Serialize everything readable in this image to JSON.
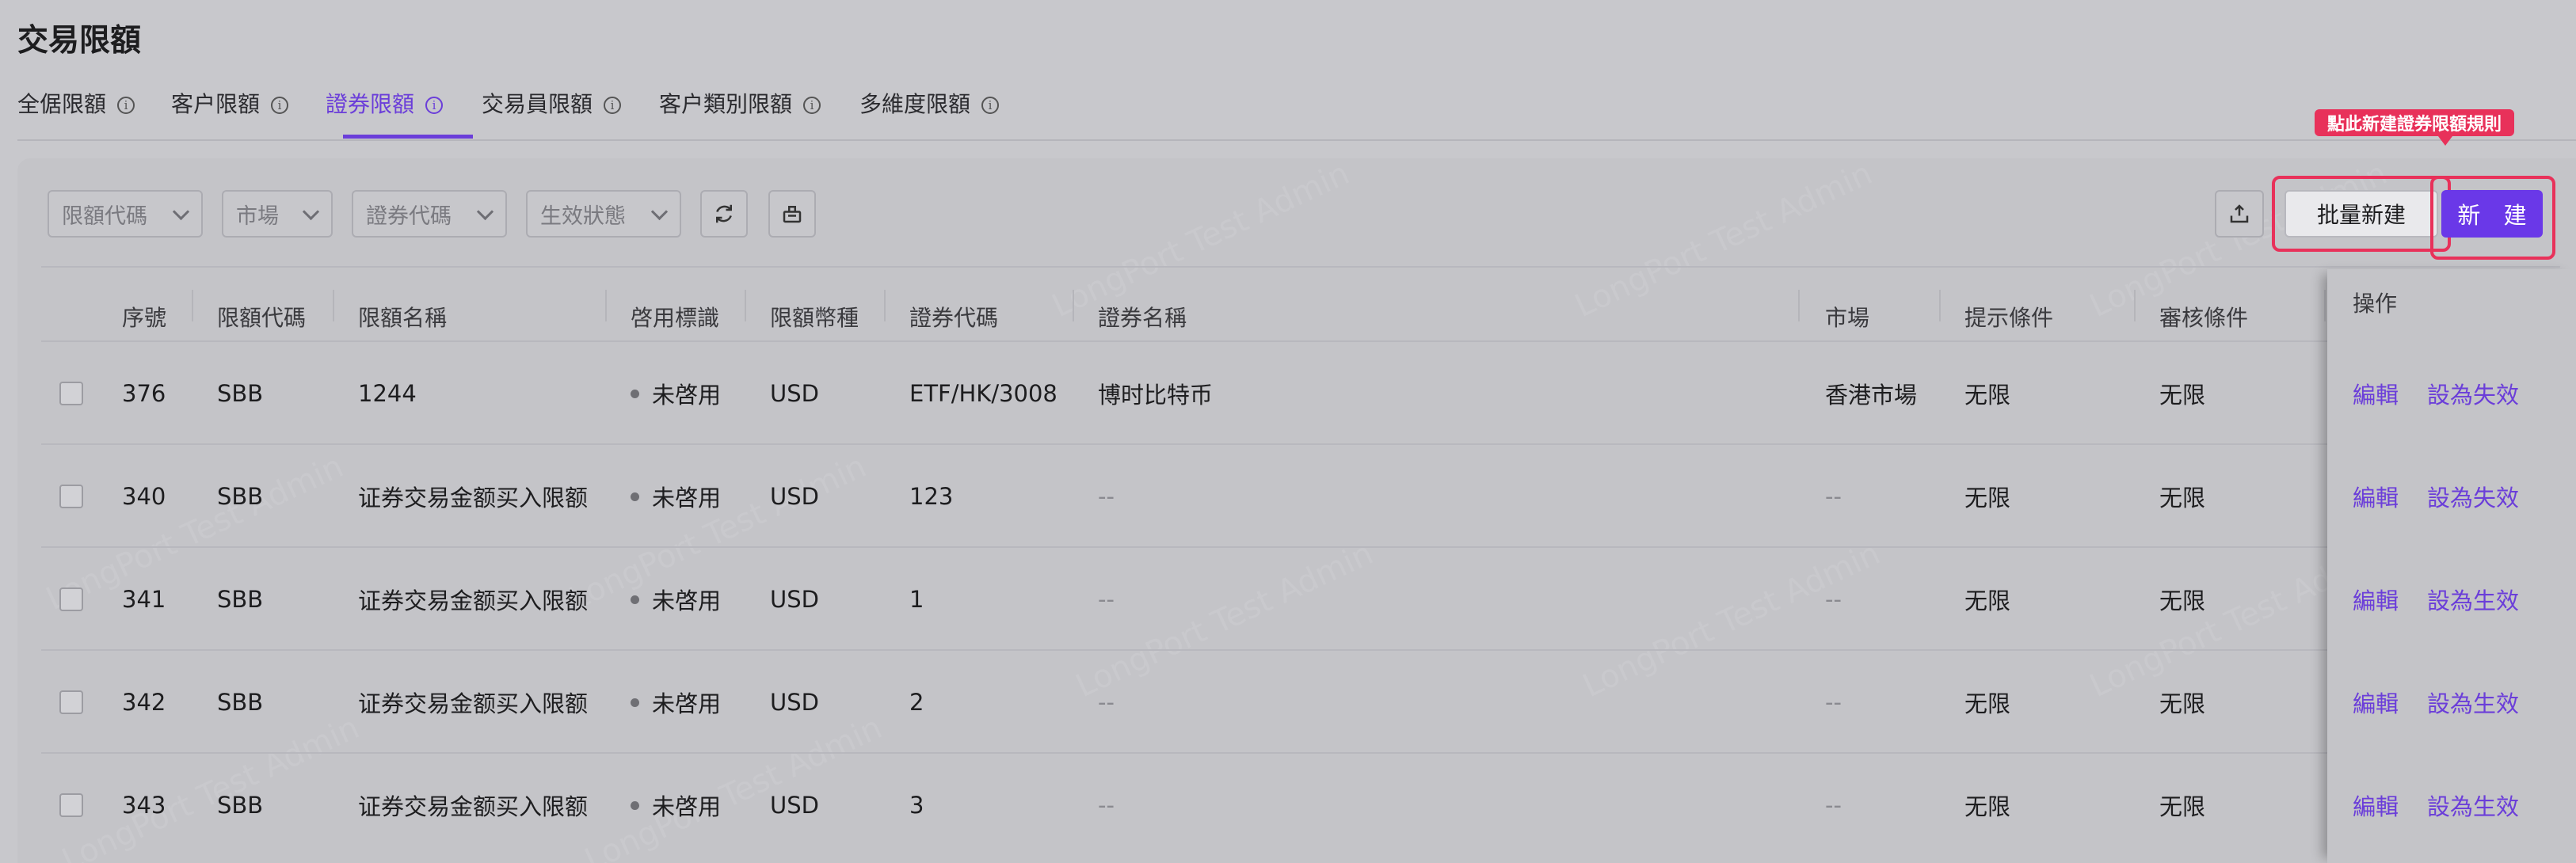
{
  "page_title": "交易限額",
  "tabs": [
    {
      "label": "全倨限額"
    },
    {
      "label": "客户限額"
    },
    {
      "label": "證券限額",
      "active": true
    },
    {
      "label": "交易員限額"
    },
    {
      "label": "客户類別限額"
    },
    {
      "label": "多維度限額"
    }
  ],
  "filters": {
    "limit_code": "限額代碼",
    "market": "市場",
    "security_code": "證券代碼",
    "status": "生效狀態"
  },
  "toolbar": {
    "batch_create": "批量新建",
    "create": "新 建",
    "tooltip": "點此新建證券限額規則"
  },
  "table": {
    "headers": {
      "seq": "序號",
      "limit_code": "限額代碼",
      "limit_name": "限額名稱",
      "enable_flag": "啓用標識",
      "currency": "限額幣種",
      "security_code": "證券代碼",
      "security_name": "證券名稱",
      "market": "市場",
      "alert": "提示條件",
      "review": "審核條件",
      "actions": "操作"
    },
    "rows": [
      {
        "seq": "376",
        "code": "SBB",
        "name": "1244",
        "flag": "未啓用",
        "currency": "USD",
        "sec_code": "ETF/HK/3008",
        "sec_name": "博时比特币",
        "market": "香港市場",
        "alert": "无限",
        "review": "无限",
        "edit": "編輯",
        "toggle": "設為失效"
      },
      {
        "seq": "340",
        "code": "SBB",
        "name": "证券交易金额买入限额",
        "flag": "未啓用",
        "currency": "USD",
        "sec_code": "123",
        "sec_name": "--",
        "market": "--",
        "alert": "无限",
        "review": "无限",
        "edit": "編輯",
        "toggle": "設為失效"
      },
      {
        "seq": "341",
        "code": "SBB",
        "name": "证券交易金额买入限额",
        "flag": "未啓用",
        "currency": "USD",
        "sec_code": "1",
        "sec_name": "--",
        "market": "--",
        "alert": "无限",
        "review": "无限",
        "edit": "編輯",
        "toggle": "設為生效"
      },
      {
        "seq": "342",
        "code": "SBB",
        "name": "证券交易金额买入限额",
        "flag": "未啓用",
        "currency": "USD",
        "sec_code": "2",
        "sec_name": "--",
        "market": "--",
        "alert": "无限",
        "review": "无限",
        "edit": "編輯",
        "toggle": "設為生效"
      },
      {
        "seq": "343",
        "code": "SBB",
        "name": "证券交易金额买入限额",
        "flag": "未啓用",
        "currency": "USD",
        "sec_code": "3",
        "sec_name": "--",
        "market": "--",
        "alert": "无限",
        "review": "无限",
        "edit": "編輯",
        "toggle": "設為生效"
      }
    ]
  },
  "watermark": "LongPort Test Admin",
  "colors": {
    "accent": "#6b3ed9",
    "highlight": "#e8315a",
    "primary_button": "#6a38e8"
  }
}
